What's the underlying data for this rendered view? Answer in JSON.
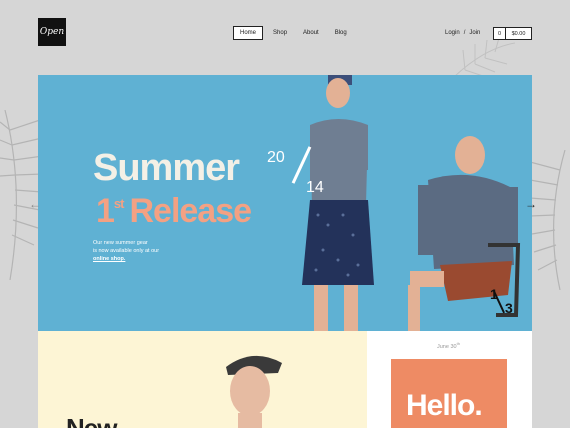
{
  "header": {
    "logo_text": "Open",
    "nav": [
      {
        "label": "Home",
        "active": true
      },
      {
        "label": "Shop",
        "active": false
      },
      {
        "label": "About",
        "active": false
      },
      {
        "label": "Blog",
        "active": false
      }
    ],
    "login": "Login",
    "auth_sep": "/",
    "join": "Join",
    "cart_count": "0",
    "cart_total": "$0.00"
  },
  "hero": {
    "title_line1": "Summer",
    "year_20": "20",
    "year_14": "14",
    "release_num": "1",
    "release_sup": "st",
    "release_word": "Release",
    "desc_1": "Our new summer gear",
    "desc_2": "is now available only at our",
    "desc_link": "online shop.",
    "slide_current": "1",
    "slide_total": "3",
    "colors": {
      "background": "#5fb1d3",
      "accent": "#f3a183",
      "light": "#f4f0e6"
    }
  },
  "bottom": {
    "new_text": "New",
    "date_text": "June 30",
    "date_sup": "th",
    "hello_text": "Hello.",
    "colors": {
      "yellow_panel": "#fdf5d5",
      "hello_card": "#ee8b64"
    }
  }
}
